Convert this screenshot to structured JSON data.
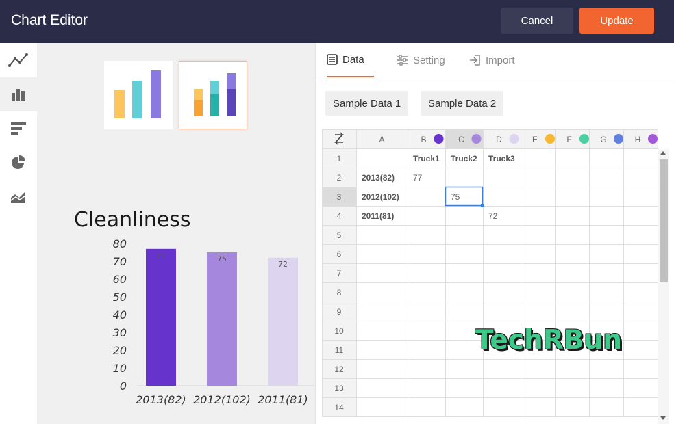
{
  "header": {
    "title": "Chart Editor",
    "cancel_label": "Cancel",
    "update_label": "Update"
  },
  "sidebar": {
    "items": [
      {
        "icon": "line-chart-icon",
        "active": false
      },
      {
        "icon": "column-chart-icon",
        "active": true
      },
      {
        "icon": "bar-chart-icon",
        "active": false
      },
      {
        "icon": "pie-chart-icon",
        "active": false
      },
      {
        "icon": "area-chart-icon",
        "active": false
      }
    ]
  },
  "thumbnails": [
    {
      "name": "grouped-column",
      "selected": false
    },
    {
      "name": "stacked-column",
      "selected": true
    }
  ],
  "tabs": [
    {
      "label": "Data",
      "icon": "data-list-icon",
      "active": true
    },
    {
      "label": "Setting",
      "icon": "sliders-icon",
      "active": false
    },
    {
      "label": "Import",
      "icon": "import-icon",
      "active": false
    }
  ],
  "samples": [
    "Sample Data 1",
    "Sample Data 2"
  ],
  "colors": {
    "accent": "#f26531",
    "header_bg": "#2b2d48",
    "series": [
      "#6633cc",
      "#a587de",
      "#ddd4ef"
    ]
  },
  "spreadsheet": {
    "columns": [
      {
        "label": "A",
        "dot": null
      },
      {
        "label": "B",
        "dot": "#6633cc"
      },
      {
        "label": "C",
        "dot": "#a587de"
      },
      {
        "label": "D",
        "dot": "#ddd4ef"
      },
      {
        "label": "E",
        "dot": "#f7b733"
      },
      {
        "label": "F",
        "dot": "#4bd0a3"
      },
      {
        "label": "G",
        "dot": "#6081e0"
      },
      {
        "label": "H",
        "dot": "#a35ad8"
      }
    ],
    "row_numbers": [
      "1",
      "2",
      "3",
      "4",
      "5",
      "6",
      "7",
      "8",
      "9",
      "10",
      "11",
      "12",
      "13",
      "14"
    ],
    "cells": [
      [
        "",
        "Truck1",
        "Truck2",
        "Truck3",
        "",
        "",
        "",
        ""
      ],
      [
        "2013(82)",
        "77",
        "",
        "",
        "",
        "",
        "",
        ""
      ],
      [
        "2012(102)",
        "",
        "75",
        "",
        "",
        "",
        "",
        ""
      ],
      [
        "2011(81)",
        "",
        "",
        "72",
        "",
        "",
        "",
        ""
      ]
    ],
    "selected_cell": {
      "row": 3,
      "col": "C"
    }
  },
  "chart_data": {
    "type": "bar",
    "title": "Cleanliness",
    "categories": [
      "2013(82)",
      "2012(102)",
      "2011(81)"
    ],
    "values": [
      77,
      75,
      72
    ],
    "data_labels": [
      "77",
      "75",
      "72"
    ],
    "bar_colors": [
      "#6633cc",
      "#a587de",
      "#ddd4ef"
    ],
    "yticks": [
      "0",
      "10",
      "20",
      "30",
      "40",
      "50",
      "60",
      "70",
      "80"
    ],
    "ylim": [
      0,
      80
    ],
    "xlabel": "",
    "ylabel": "",
    "grid": false,
    "legend": "none"
  },
  "watermark": "TechRBun"
}
